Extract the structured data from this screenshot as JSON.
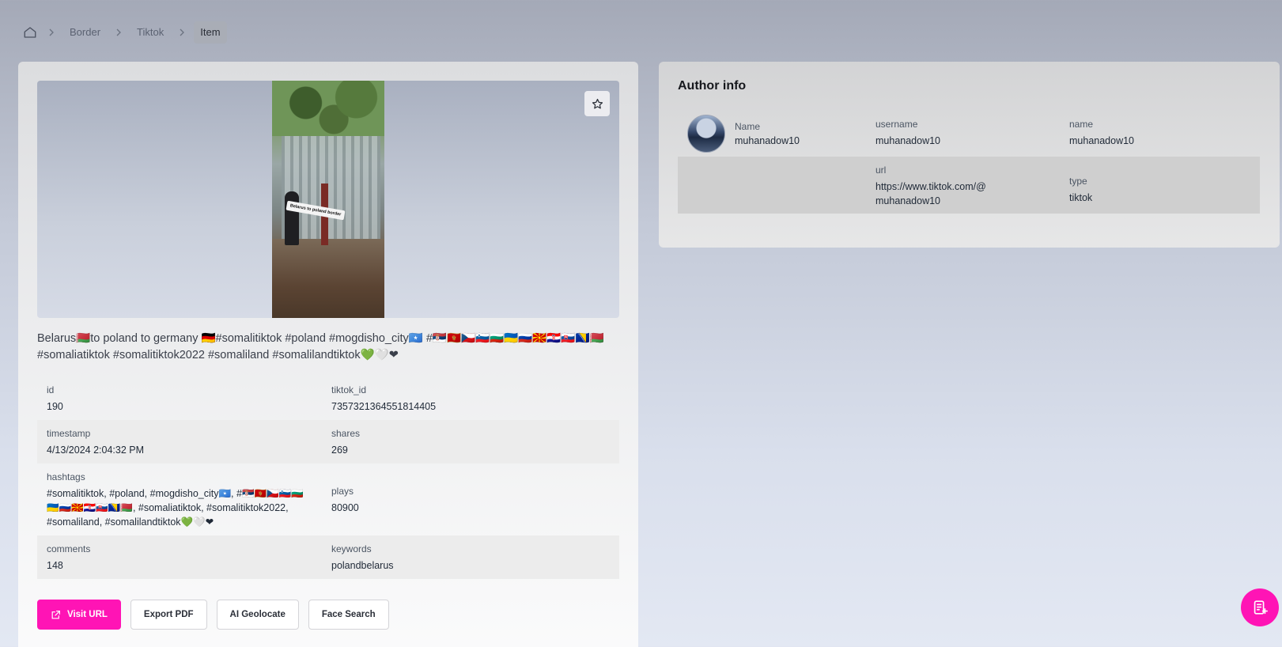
{
  "breadcrumb": {
    "items": [
      "Border",
      "Tiktok",
      "Item"
    ]
  },
  "media": {
    "banner_text": "Belarus to poland border"
  },
  "caption": "Belarus🇧🇾to poland to germany 🇩🇪#somalitiktok #poland #mogdisho_city🇸🇴 #🇷🇸🇲🇪🇨🇿🇸🇮🇧🇬🇺🇦🇷🇺🇲🇰🇭🇷🇸🇰🇧🇦🇧🇾 #somaliatiktok #somalitiktok2022 #somaliland #somalilandtiktok💚🤍❤",
  "fields": {
    "id": {
      "label": "id",
      "value": "190"
    },
    "tiktok_id": {
      "label": "tiktok_id",
      "value": "7357321364551814405"
    },
    "timestamp": {
      "label": "timestamp",
      "value": "4/13/2024 2:04:32 PM"
    },
    "shares": {
      "label": "shares",
      "value": "269"
    },
    "hashtags": {
      "label": "hashtags",
      "value": "#somalitiktok, #poland, #mogdisho_city🇸🇴, #🇷🇸🇲🇪🇨🇿🇸🇮🇧🇬🇺🇦🇷🇺🇲🇰🇭🇷🇸🇰🇧🇦🇧🇾, #somaliatiktok, #somalitiktok2022, #somaliland, #somalilandtiktok💚🤍❤"
    },
    "plays": {
      "label": "plays",
      "value": "80900"
    },
    "comments": {
      "label": "comments",
      "value": "148"
    },
    "keywords": {
      "label": "keywords",
      "value": "polandbelarus"
    }
  },
  "actions": {
    "visit_url": "Visit URL",
    "export_pdf": "Export PDF",
    "ai_geolocate": "AI Geolocate",
    "face_search": "Face Search"
  },
  "author": {
    "title": "Author info",
    "name_label": "Name",
    "name_value": "muhanadow10",
    "username_label": "username",
    "username_value": "muhanadow10",
    "name2_label": "name",
    "name2_value": "muhanadow10",
    "url_label": "url",
    "url_value": "https://www.tiktok.com/@muhanadow10",
    "type_label": "type",
    "type_value": "tiktok"
  },
  "colors": {
    "accent": "#ff14b5"
  }
}
